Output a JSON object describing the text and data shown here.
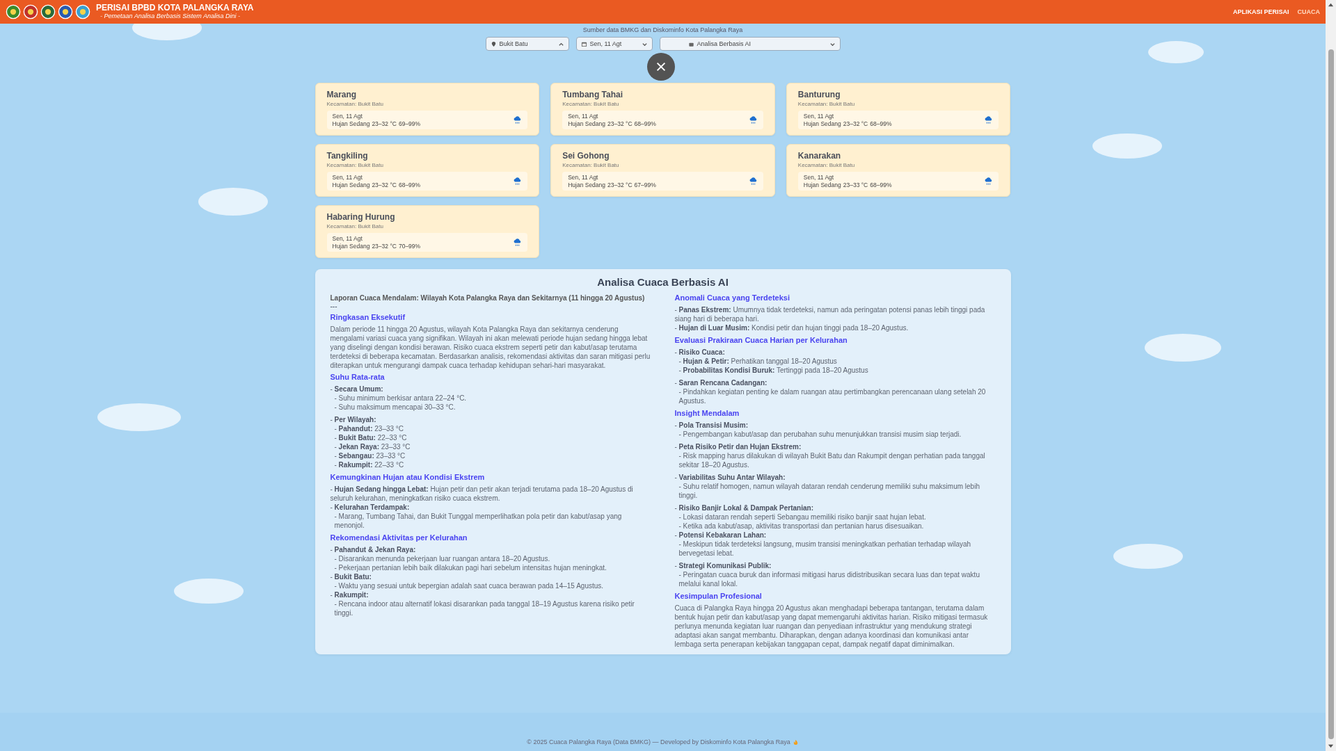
{
  "header": {
    "title": "PERISAI BPBD KOTA PALANGKA RAYA",
    "subtitle": "- Pemetaan Analisa Berbasis Sistem Analisa Dini -",
    "nav": [
      {
        "label": "APLIKASI PERISAI",
        "selected": false
      },
      {
        "label": "CUACA",
        "selected": true
      }
    ]
  },
  "source_note": "Sumber data BMKG dan Diskominfo Kota Palangka Raya",
  "filters": [
    {
      "kind": "location",
      "label": "Bukit Batu",
      "expanded": true
    },
    {
      "kind": "date",
      "label": "Sen, 11 Agt",
      "expanded": false
    },
    {
      "kind": "mode",
      "label": "Analisa Berbasis AI",
      "expanded": false
    }
  ],
  "cards": [
    {
      "name": "Marang",
      "district": "Kecamatan: Bukit Batu",
      "date": "Sen, 11 Agt",
      "condition": "Hujan Sedang",
      "temperature": "23–32 °C",
      "humidity": "69–99%"
    },
    {
      "name": "Tumbang Tahai",
      "district": "Kecamatan: Bukit Batu",
      "date": "Sen, 11 Agt",
      "condition": "Hujan Sedang",
      "temperature": "23–32 °C",
      "humidity": "68–99%"
    },
    {
      "name": "Banturung",
      "district": "Kecamatan: Bukit Batu",
      "date": "Sen, 11 Agt",
      "condition": "Hujan Sedang",
      "temperature": "23–32 °C",
      "humidity": "68–99%"
    },
    {
      "name": "Tangkiling",
      "district": "Kecamatan: Bukit Batu",
      "date": "Sen, 11 Agt",
      "condition": "Hujan Sedang",
      "temperature": "23–32 °C",
      "humidity": "68–99%"
    },
    {
      "name": "Sei Gohong",
      "district": "Kecamatan: Bukit Batu",
      "date": "Sen, 11 Agt",
      "condition": "Hujan Sedang",
      "temperature": "23–32 °C",
      "humidity": "67–99%"
    },
    {
      "name": "Kanarakan",
      "district": "Kecamatan: Bukit Batu",
      "date": "Sen, 11 Agt",
      "condition": "Hujan Sedang",
      "temperature": "23–33 °C",
      "humidity": "68–99%"
    },
    {
      "name": "Habaring Hurung",
      "district": "Kecamatan: Bukit Batu",
      "date": "Sen, 11 Agt",
      "condition": "Hujan Sedang",
      "temperature": "23–32 °C",
      "humidity": "70–99%"
    }
  ],
  "report": {
    "title": "Analisa Cuaca Berbasis AI",
    "intro": "Laporan Cuaca Mendalam: Wilayah Kota Palangka Raya dan Sekitarnya (11 hingga 20 Agustus)",
    "rule": "---",
    "sections": [
      {
        "heading": "Ringkasan Eksekutif",
        "paragraph": "Dalam periode 11 hingga 20 Agustus, wilayah Kota Palangka Raya dan sekitarnya cenderung mengalami variasi cuaca yang signifikan. Wilayah ini akan melewati periode hujan sedang hingga lebat yang diselingi dengan kondisi berawan. Risiko cuaca ekstrem seperti petir dan kabut/asap terutama terdeteksi di beberapa kecamatan. Berdasarkan analisis, rekomendasi aktivitas dan saran mitigasi perlu diterapkan untuk mengurangi dampak cuaca terhadap kehidupan sehari-hari masyarakat."
      },
      {
        "heading": "Suhu Rata-rata",
        "groups": [
          [
            {
              "text": "- **Secara Umum:**",
              "children": [
                {
                  "text": "- Suhu minimum berkisar antara 22–24 °C."
                },
                {
                  "text": "- Suhu maksimum mencapai 30–33 °C."
                }
              ]
            }
          ],
          [
            {
              "text": "- **Per Wilayah:**",
              "children": [
                {
                  "text": "- **Pahandut:** 23–33 °C"
                },
                {
                  "text": "- **Bukit Batu:** 22–33 °C"
                },
                {
                  "text": "- **Jekan Raya:** 23–33 °C"
                },
                {
                  "text": "- **Sebangau:** 23–33 °C"
                },
                {
                  "text": "- **Rakumpit:** 22–33 °C"
                }
              ]
            }
          ]
        ]
      },
      {
        "heading": "Kemungkinan Hujan atau Kondisi Ekstrem",
        "groups": [
          [
            {
              "text": "- **Hujan Sedang hingga Lebat:** Hujan petir dan petir akan terjadi terutama pada 18–20 Agustus di seluruh kelurahan, meningkatkan risiko cuaca ekstrem."
            },
            {
              "text": "- **Kelurahan Terdampak:**",
              "children": [
                {
                  "text": "- Marang, Tumbang Tahai, dan Bukit Tunggal memperlihatkan pola petir dan kabut/asap yang menonjol."
                }
              ]
            }
          ]
        ]
      },
      {
        "heading": "Rekomendasi Aktivitas per Kelurahan",
        "groups": [
          [
            {
              "text": "- **Pahandut & Jekan Raya:**",
              "children": [
                {
                  "text": "- Disarankan menunda pekerjaan luar ruangan antara 18–20 Agustus."
                },
                {
                  "text": "- Pekerjaan pertanian lebih baik dilakukan pagi hari sebelum intensitas hujan meningkat."
                }
              ]
            },
            {
              "text": "- **Bukit Batu:**",
              "children": [
                {
                  "text": "- Waktu yang sesuai untuk bepergian adalah saat cuaca berawan pada 14–15 Agustus."
                }
              ]
            },
            {
              "text": "- **Rakumpit:**",
              "children": [
                {
                  "text": "- Rencana indoor atau alternatif lokasi disarankan pada tanggal 18–19 Agustus karena risiko petir tinggi."
                }
              ]
            }
          ]
        ]
      },
      {
        "heading": "Anomali Cuaca yang Terdeteksi",
        "groups": [
          [
            {
              "text": "- **Panas Ekstrem:** Umumnya tidak terdeteksi, namun ada peringatan potensi panas lebih tinggi pada siang hari di beberapa hari."
            },
            {
              "text": "- **Hujan di Luar Musim:** Kondisi petir dan hujan tinggi pada 18–20 Agustus."
            }
          ]
        ]
      },
      {
        "heading": "Evaluasi Prakiraan Cuaca Harian per Kelurahan",
        "groups": [
          [
            {
              "text": "- **Risiko Cuaca:**",
              "children": [
                {
                  "text": "- **Hujan & Petir:** Perhatikan tanggal 18–20 Agustus"
                },
                {
                  "text": "- **Probabilitas Kondisi Buruk:** Tertinggi pada 18–20 Agustus"
                }
              ]
            }
          ],
          [
            {
              "text": "- **Saran Rencana Cadangan:**",
              "children": [
                {
                  "text": "- Pindahkan kegiatan penting ke dalam ruangan atau pertimbangkan perencanaan ulang setelah 20 Agustus."
                }
              ]
            }
          ]
        ]
      },
      {
        "heading": "Insight Mendalam",
        "groups": [
          [
            {
              "text": "- **Pola Transisi Musim:**",
              "children": [
                {
                  "text": "- Pengembangan kabut/asap dan perubahan suhu menunjukkan transisi musim siap terjadi."
                }
              ]
            }
          ],
          [
            {
              "text": "- **Peta Risiko Petir dan Hujan Ekstrem:**",
              "children": [
                {
                  "text": "- Risk mapping harus dilakukan di wilayah Bukit Batu dan Rakumpit dengan perhatian pada tanggal sekitar 18–20 Agustus."
                }
              ]
            }
          ],
          [
            {
              "text": "- **Variabilitas Suhu Antar Wilayah:**",
              "children": [
                {
                  "text": "- Suhu relatif homogen, namun wilayah dataran rendah cenderung memiliki suhu maksimum lebih tinggi."
                }
              ]
            }
          ],
          [
            {
              "text": "- **Risiko Banjir Lokal & Dampak Pertanian:**",
              "children": [
                {
                  "text": "- Lokasi dataran rendah seperti Sebangau memiliki risiko banjir saat hujan lebat."
                },
                {
                  "text": "- Ketika ada kabut/asap, aktivitas transportasi dan pertanian harus disesuaikan."
                }
              ]
            },
            {
              "text": "- **Potensi Kebakaran Lahan:**",
              "children": [
                {
                  "text": "- Meskipun tidak terdeteksi langsung, musim transisi meningkatkan perhatian terhadap wilayah bervegetasi lebat."
                }
              ]
            }
          ],
          [
            {
              "text": "- **Strategi Komunikasi Publik:**",
              "children": [
                {
                  "text": "- Peringatan cuaca buruk dan informasi mitigasi harus didistribusikan secara luas dan tepat waktu melalui kanal lokal."
                }
              ]
            }
          ]
        ]
      },
      {
        "heading": "Kesimpulan Profesional",
        "paragraph": "Cuaca di Palangka Raya hingga 20 Agustus akan menghadapi beberapa tantangan, terutama dalam bentuk hujan petir dan kabut/asap yang dapat memengaruhi aktivitas harian. Risiko mitigasi termasuk perlunya menunda kegiatan luar ruangan dan penyediaan infrastruktur yang mendukung strategi adaptasi akan sangat membantu. Diharapkan, dengan adanya koordinasi dan komunikasi antar lembaga serta penerapan kebijakan tanggapan cepat, dampak negatif dapat diminimalkan."
      }
    ]
  },
  "footer": "© 2025 Cuaca Palangka Raya (Data BMKG) — Developed by Diskominfo Kota Palangka Raya"
}
